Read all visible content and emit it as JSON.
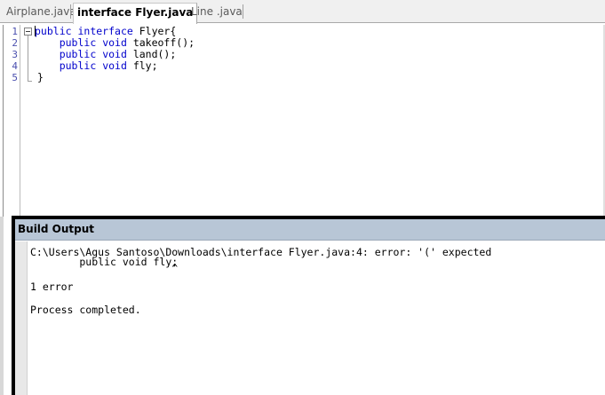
{
  "tabs": [
    {
      "label": "Airplane.java",
      "active": false
    },
    {
      "label": "interface Flyer.java",
      "active": true
    },
    {
      "label": "Line .java",
      "active": false
    }
  ],
  "editor": {
    "line_numbers": [
      "1",
      "2",
      "3",
      "4",
      "5"
    ],
    "lines": [
      [
        {
          "t": "public",
          "kw": true
        },
        {
          "t": " ",
          "kw": false
        },
        {
          "t": "interface",
          "kw": true
        },
        {
          "t": " Flyer{",
          "kw": false
        }
      ],
      [
        {
          "t": "    ",
          "kw": false
        },
        {
          "t": "public",
          "kw": true
        },
        {
          "t": " ",
          "kw": false
        },
        {
          "t": "void",
          "kw": true
        },
        {
          "t": " takeoff();",
          "kw": false
        }
      ],
      [
        {
          "t": "    ",
          "kw": false
        },
        {
          "t": "public",
          "kw": true
        },
        {
          "t": " ",
          "kw": false
        },
        {
          "t": "void",
          "kw": true
        },
        {
          "t": " land();",
          "kw": false
        }
      ],
      [
        {
          "t": "    ",
          "kw": false
        },
        {
          "t": "public",
          "kw": true
        },
        {
          "t": " ",
          "kw": false
        },
        {
          "t": "void",
          "kw": true
        },
        {
          "t": " fly;",
          "kw": false
        }
      ],
      [
        {
          "t": "}",
          "kw": false
        }
      ]
    ],
    "keyword_color": "#0000cc",
    "line_number_color": "#4a4fae"
  },
  "build_output": {
    "title": "Build Output",
    "header_color": "#b8c6d6",
    "lines": [
      "C:\\Users\\Agus Santoso\\Downloads\\interface Flyer.java:4: error: '(' expected",
      "        public void fly;",
      "                       ^",
      "1 error",
      "Process completed."
    ]
  }
}
